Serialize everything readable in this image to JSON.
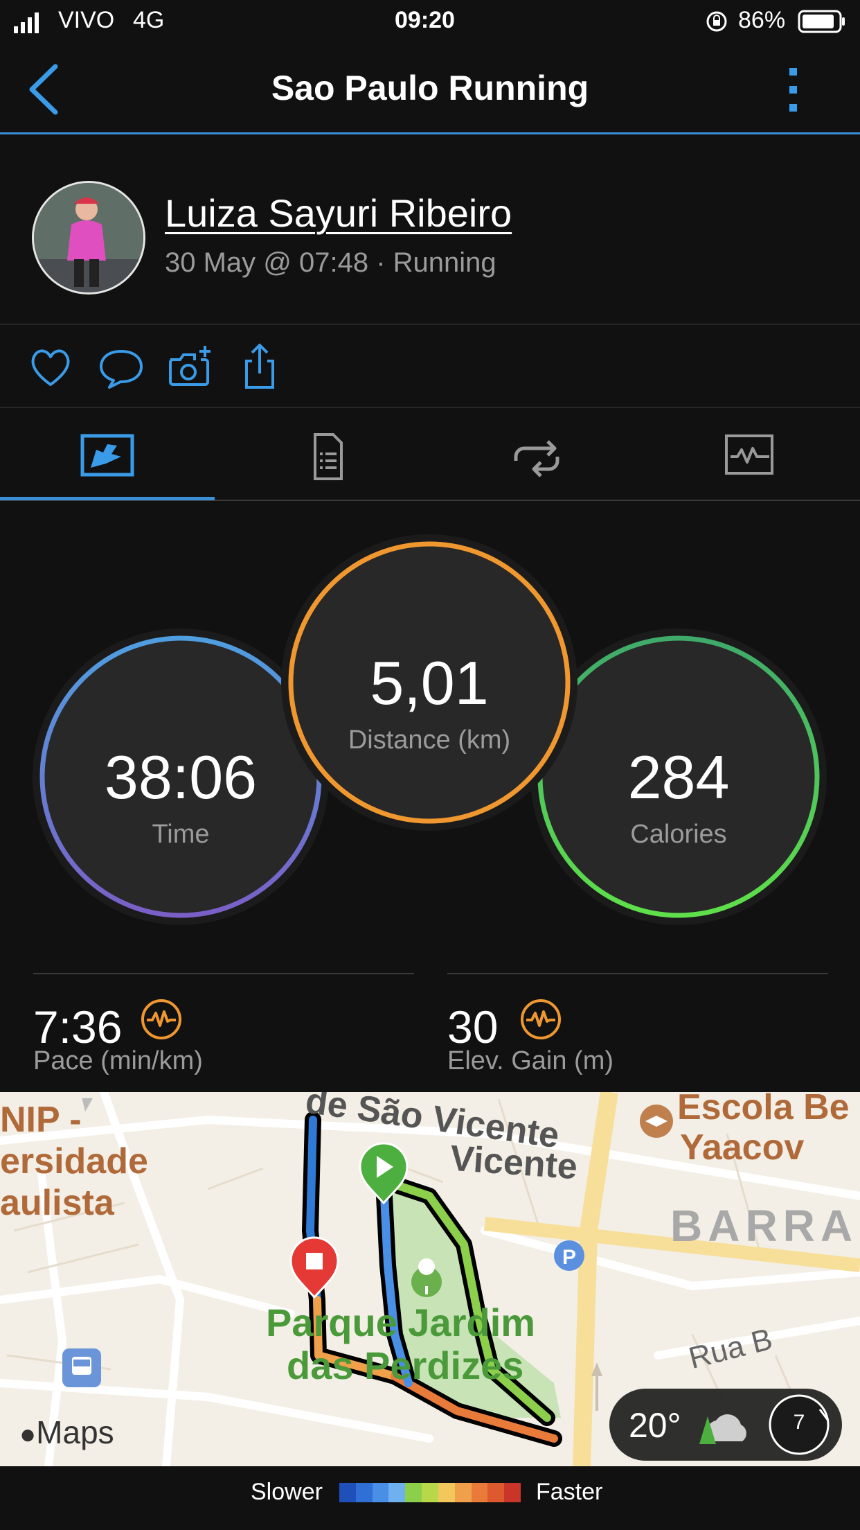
{
  "status_bar": {
    "carrier": "VIVO",
    "network": "4G",
    "time": "09:20",
    "battery": "86%"
  },
  "nav": {
    "title": "Sao Paulo Running",
    "back_icon": "chevron-left-icon",
    "menu_icon": "vertical-dots-icon"
  },
  "profile": {
    "name": "Luiza Sayuri Ribeiro",
    "meta": "30 May @ 07:48 · Running"
  },
  "actions": [
    "heart-icon",
    "comment-icon",
    "camera-plus-icon",
    "share-icon"
  ],
  "tabs": [
    {
      "icon": "map-overview-icon",
      "active": true
    },
    {
      "icon": "details-document-icon",
      "active": false
    },
    {
      "icon": "laps-loop-icon",
      "active": false
    },
    {
      "icon": "chart-graph-icon",
      "active": false
    }
  ],
  "metrics": {
    "time": {
      "value": "38:06",
      "label": "Time"
    },
    "distance": {
      "value": "5,01",
      "label": "Distance (km)"
    },
    "calories": {
      "value": "284",
      "label": "Calories"
    }
  },
  "stats": {
    "pace": {
      "value": "7:36",
      "label": "Pace (min/km)"
    },
    "elev": {
      "value": "30",
      "label": "Elev. Gain (m)"
    }
  },
  "map": {
    "labels": {
      "street": "de São Vicente",
      "school1": "Escola Be",
      "school2": "Yaacov",
      "uni1": "NIP -",
      "uni2": "ersidade",
      "uni3": "aulista",
      "district": "BARRA",
      "park1": "Parque Jardim",
      "park2": "das Perdizes",
      "rua": "Rua B"
    },
    "attribution": "Maps",
    "weather": {
      "temp": "20°",
      "wind": "7"
    }
  },
  "legend": {
    "slower": "Slower",
    "faster": "Faster",
    "colors": [
      "#1f4fb8",
      "#2f6fd6",
      "#4a8fe6",
      "#6fb0f0",
      "#8ccf4a",
      "#b8d84a",
      "#f2c75c",
      "#f0a04a",
      "#e87a3a",
      "#dd5a2e",
      "#c93528"
    ]
  }
}
